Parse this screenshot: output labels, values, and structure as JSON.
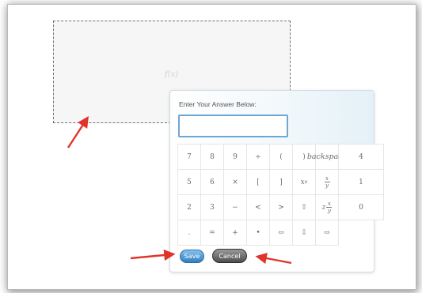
{
  "function_box": {
    "label": "f(x)"
  },
  "editor": {
    "prompt": "Enter Your Answer Below:",
    "answer_value": "",
    "keys": [
      {
        "name": "key-7",
        "label": "7"
      },
      {
        "name": "key-8",
        "label": "8"
      },
      {
        "name": "key-9",
        "label": "9"
      },
      {
        "name": "key-divide",
        "label": "÷"
      },
      {
        "name": "key-open-paren",
        "label": "("
      },
      {
        "name": "key-close-paren",
        "label": ")"
      },
      {
        "name": "key-backspace",
        "label": "backspace",
        "wide": true
      },
      {
        "name": "key-4",
        "label": "4"
      },
      {
        "name": "key-5",
        "label": "5"
      },
      {
        "name": "key-6",
        "label": "6"
      },
      {
        "name": "key-multiply",
        "label": "×"
      },
      {
        "name": "key-open-bracket",
        "label": "["
      },
      {
        "name": "key-close-bracket",
        "label": "]"
      },
      {
        "name": "key-power",
        "label": "x",
        "sup": "a"
      },
      {
        "name": "key-fraction",
        "label": "x",
        "frac_bottom": "y"
      },
      {
        "name": "key-1",
        "label": "1"
      },
      {
        "name": "key-2",
        "label": "2"
      },
      {
        "name": "key-3",
        "label": "3"
      },
      {
        "name": "key-minus",
        "label": "−"
      },
      {
        "name": "key-less-than",
        "label": "<"
      },
      {
        "name": "key-greater-than",
        "label": ">"
      },
      {
        "name": "key-arrow-up",
        "label": "⇧"
      },
      {
        "name": "key-mixed-fraction",
        "prefix": "z",
        "label": "x",
        "frac_bottom": "y"
      },
      {
        "name": "key-0",
        "label": "0"
      },
      {
        "name": "key-decimal",
        "label": "."
      },
      {
        "name": "key-equals",
        "label": "="
      },
      {
        "name": "key-plus",
        "label": "+"
      },
      {
        "name": "key-times-dot",
        "label": "•"
      },
      {
        "name": "key-arrow-left",
        "label": "⇦"
      },
      {
        "name": "key-arrow-down",
        "label": "⇩"
      },
      {
        "name": "key-arrow-right",
        "label": "⇨"
      }
    ],
    "save_label": "Save",
    "cancel_label": "Cancel"
  },
  "colors": {
    "annotation_arrow": "#e0342b",
    "save_button": "#3a89c9",
    "cancel_button": "#5c5c5c",
    "answer_border": "#6ea7d4"
  }
}
